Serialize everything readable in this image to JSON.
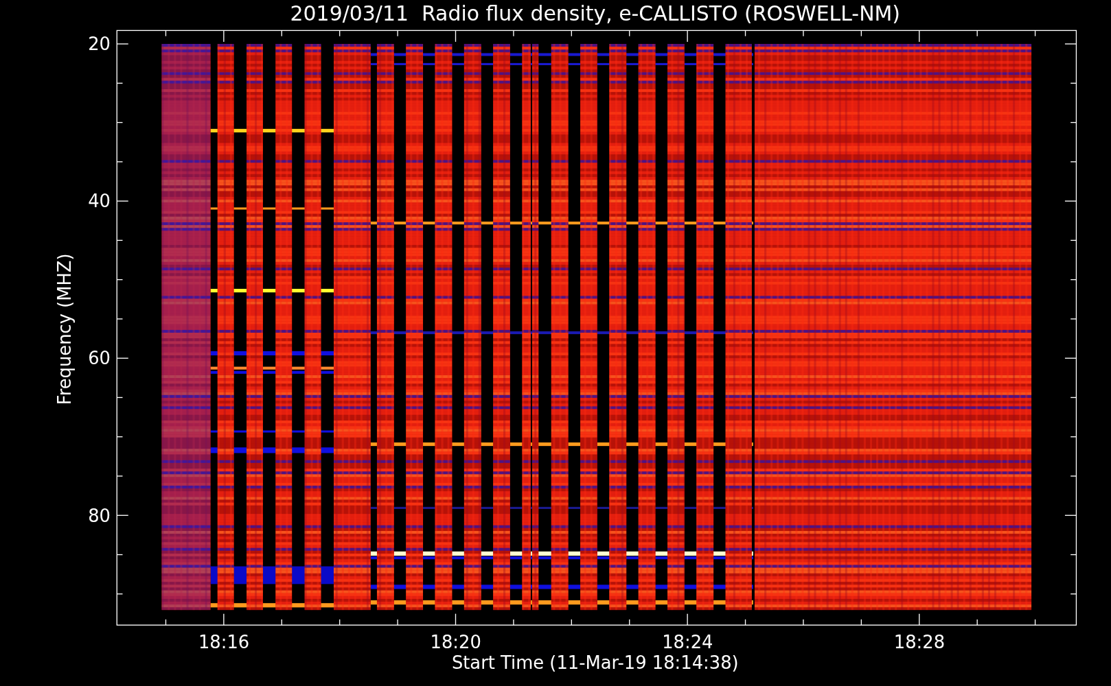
{
  "title": "2019/03/11  Radio flux density, e-CALLISTO (ROSWELL-NM)",
  "y_axis": {
    "label": "Frequency (MHZ)",
    "ticks": [
      "20",
      "40",
      "60",
      "80"
    ]
  },
  "x_axis": {
    "label": "Start Time (11-Mar-19 18:14:38)",
    "ticks": [
      "18:16",
      "18:20",
      "18:24",
      "18:28"
    ]
  }
}
